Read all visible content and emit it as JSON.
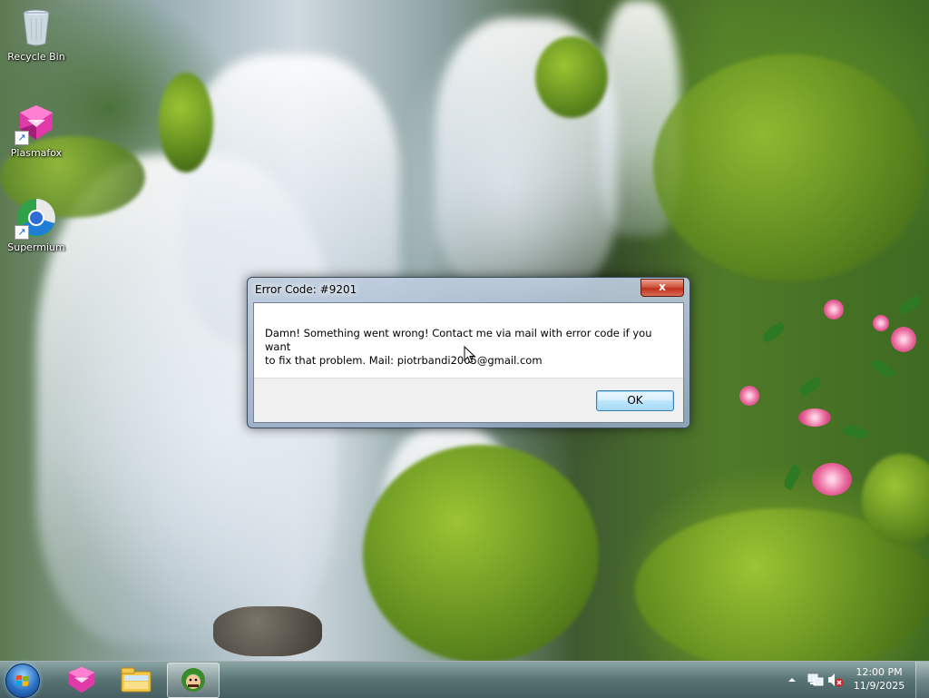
{
  "desktop": {
    "icons": [
      {
        "label": "Recycle Bin",
        "icon": "recycle-bin-icon"
      },
      {
        "label": "Plasmafox",
        "icon": "plasmafox-icon"
      },
      {
        "label": "Supermium",
        "icon": "supermium-icon"
      }
    ]
  },
  "dialog": {
    "title": "Error Code: #9201",
    "close_label": "x",
    "message_line1": "Damn! Something went wrong! Contact me via mail with error code if you want",
    "message_line2": "to fix that problem. Mail: piotrbandi2005@gmail.com",
    "ok_label": "OK"
  },
  "taskbar": {
    "start_icon": "windows-start-orb",
    "pinned": [
      {
        "name": "plasmafox-icon"
      },
      {
        "name": "file-explorer-icon"
      },
      {
        "name": "mario-app-icon",
        "active": true
      }
    ],
    "tray": {
      "icons": [
        "show-hidden-icons-arrow",
        "network-icon",
        "volume-muted-icon"
      ],
      "time": "12:00 PM",
      "date": "11/9/2025"
    }
  }
}
